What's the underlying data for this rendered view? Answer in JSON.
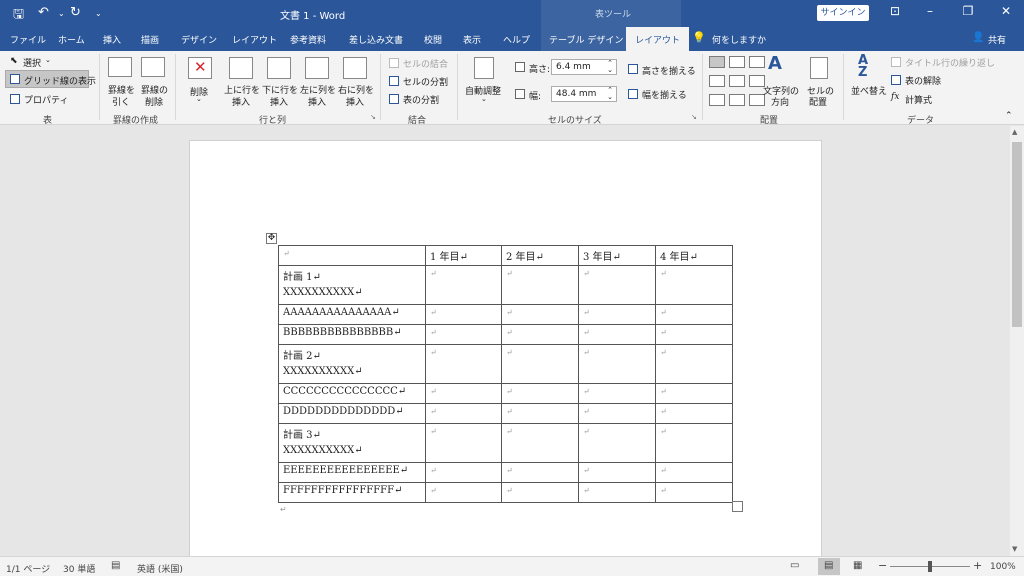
{
  "title": "文書 1 - Word",
  "table_tools": "表ツール",
  "signin": "サインイン",
  "share": "共有",
  "tabs": [
    "ファイル",
    "ホーム",
    "挿入",
    "描画",
    "デザイン",
    "レイアウト",
    "参考資料",
    "差し込み文書",
    "校閲",
    "表示",
    "ヘルプ",
    "テーブル デザイン",
    "レイアウト",
    "何をしますか"
  ],
  "ribbon": {
    "select": "選択",
    "gridlines": "グリッド線の表示",
    "properties": "プロパティ",
    "group_table": "表",
    "draw_line": [
      "罫線を",
      "引く"
    ],
    "erase_line": [
      "罫線の",
      "削除"
    ],
    "group_draw": "罫線の作成",
    "delete": "削除",
    "insert_above": [
      "上に行を",
      "挿入"
    ],
    "insert_below": [
      "下に行を",
      "挿入"
    ],
    "insert_left": [
      "左に列を",
      "挿入"
    ],
    "insert_right": [
      "右に列を",
      "挿入"
    ],
    "group_rowcol": "行と列",
    "merge_cells": "セルの結合",
    "split_cells": "セルの分割",
    "split_table": "表の分割",
    "group_merge": "結合",
    "autofit": "自動調整",
    "height_label": "高さ:",
    "height_value": "6.4 mm",
    "width_label": "幅:",
    "width_value": "48.4 mm",
    "distribute_rows": "高さを揃える",
    "distribute_cols": "幅を揃える",
    "group_cellsize": "セルのサイズ",
    "text_direction": [
      "文字列の",
      "方向"
    ],
    "cell_margins": [
      "セルの",
      "配置"
    ],
    "group_align": "配置",
    "sort": "並べ替え",
    "repeat_header": "タイトル行の繰り返し",
    "convert_text": "表の解除",
    "formula": "計算式",
    "group_data": "データ"
  },
  "table": {
    "headers": [
      "↵",
      "1 年目↵",
      "2 年目↵",
      "3 年目↵",
      "4 年目↵"
    ],
    "rows": [
      {
        "line1": "計画 1↵",
        "line2": "XXXXXXXXXX↵",
        "indent": false
      },
      {
        "line1": "AAAAAAAAAAAAAAA↵",
        "indent": true
      },
      {
        "line1": "BBBBBBBBBBBBBBB↵",
        "indent": true
      },
      {
        "line1": "計画 2↵",
        "line2": "XXXXXXXXXX↵",
        "indent": false
      },
      {
        "line1": "CCCCCCCCCCCCCCC↵",
        "indent": true
      },
      {
        "line1": "DDDDDDDDDDDDDD↵",
        "indent": true
      },
      {
        "line1": "計画 3↵",
        "line2": "XXXXXXXXXX↵",
        "indent": false
      },
      {
        "line1": "EEEEEEEEEEEEEEEE↵",
        "indent": true
      },
      {
        "line1": "FFFFFFFFFFFFFFFF↵",
        "indent": true
      }
    ],
    "cell_mark": "↵"
  },
  "status": {
    "page": "1/1 ページ",
    "words": "30 単語",
    "language": "英語 (米国)",
    "zoom": "100%"
  }
}
